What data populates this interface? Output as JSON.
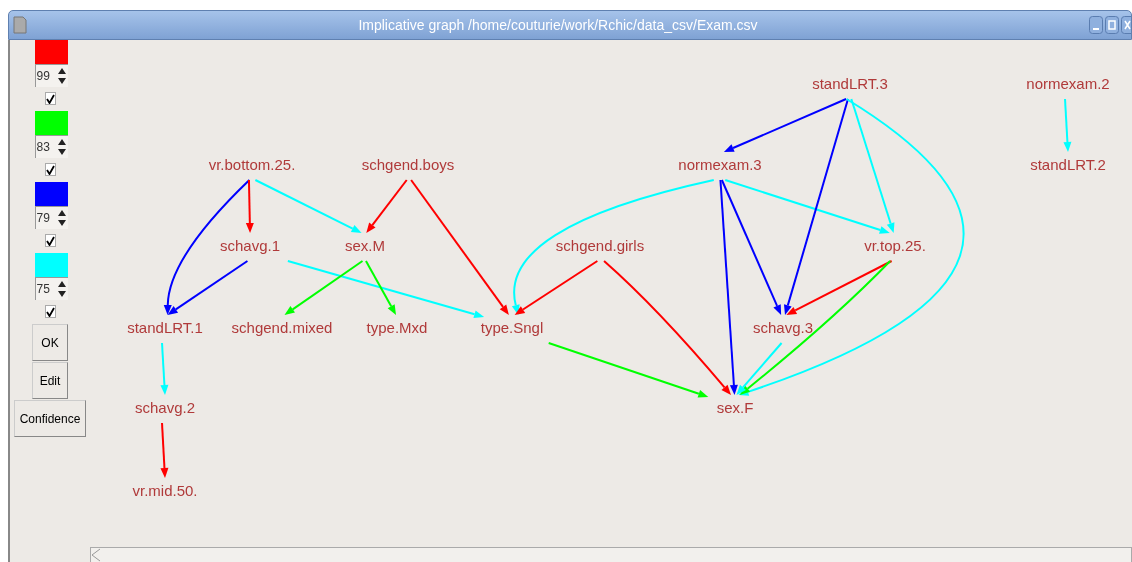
{
  "window": {
    "title": "Implicative graph /home/couturie/work/Rchic/data_csv/Exam.csv"
  },
  "thresholds": [
    {
      "color": "#ff0000",
      "value": "99",
      "checked": true
    },
    {
      "color": "#00ff00",
      "value": "83",
      "checked": true
    },
    {
      "color": "#0000ff",
      "value": "79",
      "checked": true
    },
    {
      "color": "#00ffff",
      "value": "75",
      "checked": true
    }
  ],
  "buttons": [
    "OK",
    "Edit",
    "Confidence"
  ],
  "graph": {
    "nodes": [
      "vr.bottom.25.",
      "schgend.boys",
      "normexam.3",
      "standLRT.3",
      "normexam.2",
      "standLRT.2",
      "schavg.1",
      "sex.M",
      "schgend.girls",
      "vr.top.25.",
      "standLRT.1",
      "schgend.mixed",
      "type.Mxd",
      "type.Sngl",
      "schavg.3",
      "schavg.2",
      "sex.F",
      "vr.mid.50."
    ],
    "edges": [
      {
        "color": "#0000ff"
      },
      {
        "color": "#ff0000"
      },
      {
        "color": "#00ffff"
      },
      {
        "color": "#ff0000"
      },
      {
        "color": "#ff0000"
      },
      {
        "color": "#0000ff"
      },
      {
        "color": "#00ffff"
      },
      {
        "color": "#00ff00"
      },
      {
        "color": "#00ff00"
      },
      {
        "color": "#00ffff"
      },
      {
        "color": "#ff0000"
      },
      {
        "color": "#00ffff"
      },
      {
        "color": "#0000ff"
      },
      {
        "color": "#0000ff"
      },
      {
        "color": "#00ffff"
      },
      {
        "color": "#0000ff"
      },
      {
        "color": "#0000ff"
      },
      {
        "color": "#00ffff"
      },
      {
        "color": "#00ffff"
      },
      {
        "color": "#ff0000"
      },
      {
        "color": "#ff0000"
      },
      {
        "color": "#00ff00"
      },
      {
        "color": "#ff0000"
      },
      {
        "color": "#00ff00"
      },
      {
        "color": "#00ffff"
      },
      {
        "color": "#00ffff"
      }
    ]
  }
}
